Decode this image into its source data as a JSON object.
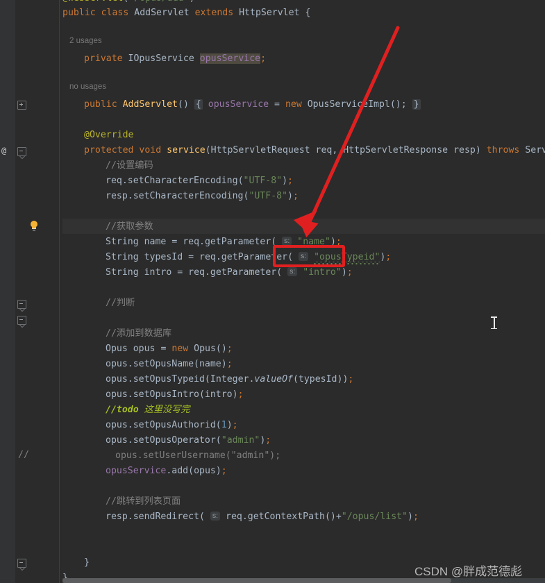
{
  "editor": {
    "language": "Java",
    "theme": "Darcula",
    "font_size": "13px",
    "background": "#2b2b2b",
    "current_line_background": "#323232"
  },
  "gutter": {
    "usage_hints": [
      {
        "text": "2 usages"
      },
      {
        "text": "no usages"
      }
    ],
    "annotation_at": "@",
    "commented_marker": "//",
    "bulb_icon": "lightbulb-intention-icon"
  },
  "code": {
    "lines": [
      {
        "id": "l0",
        "text": "@WebServlet(\"/opus/add\")"
      },
      {
        "id": "l1",
        "text": "public class AddServlet extends HttpServlet {"
      },
      {
        "id": "l2",
        "text": ""
      },
      {
        "id": "l3",
        "text": "2 usages"
      },
      {
        "id": "l4",
        "text": "private IOpusService opusService;"
      },
      {
        "id": "l5",
        "text": ""
      },
      {
        "id": "l6",
        "text": "no usages"
      },
      {
        "id": "l7",
        "text": "public AddServlet() { opusService = new OpusServiceImpl(); }"
      },
      {
        "id": "l8",
        "text": ""
      },
      {
        "id": "l9",
        "text": "@Override"
      },
      {
        "id": "l10",
        "text": "protected void service(HttpServletRequest req, HttpServletResponse resp) throws ServletExc"
      },
      {
        "id": "l11",
        "text": "//设置编码"
      },
      {
        "id": "l12",
        "text": "req.setCharacterEncoding(\"UTF-8\");"
      },
      {
        "id": "l13",
        "text": "resp.setCharacterEncoding(\"UTF-8\");"
      },
      {
        "id": "l14",
        "text": ""
      },
      {
        "id": "l15",
        "text": "//获取参数"
      },
      {
        "id": "l16",
        "text": "String name = req.getParameter( s: \"name\");"
      },
      {
        "id": "l17",
        "text": "String typesId = req.getParameter( s: \"opusTypeid\");"
      },
      {
        "id": "l18",
        "text": "String intro = req.getParameter( s: \"intro\");"
      },
      {
        "id": "l19",
        "text": ""
      },
      {
        "id": "l20",
        "text": "//判断"
      },
      {
        "id": "l21",
        "text": ""
      },
      {
        "id": "l22",
        "text": "//添加到数据库"
      },
      {
        "id": "l23",
        "text": "Opus opus = new Opus();"
      },
      {
        "id": "l24",
        "text": "opus.setOpusName(name);"
      },
      {
        "id": "l25",
        "text": "opus.setOpusTypeid(Integer.valueOf(typesId));"
      },
      {
        "id": "l26",
        "text": "opus.setOpusIntro(intro);"
      },
      {
        "id": "l27",
        "text": "//todo 这里没写完"
      },
      {
        "id": "l28",
        "text": "opus.setOpusAuthorid(1);"
      },
      {
        "id": "l29",
        "text": "opus.setOpusOperator(\"admin\");"
      },
      {
        "id": "l30",
        "text": "opus.setUserUsername(\"admin\");"
      },
      {
        "id": "l31",
        "text": "opusService.add(opus);"
      },
      {
        "id": "l32",
        "text": ""
      },
      {
        "id": "l33",
        "text": "//跳转到列表页面"
      },
      {
        "id": "l34",
        "text": "resp.sendRedirect( s: req.getContextPath()+\"/opus/list\");"
      },
      {
        "id": "l35",
        "text": ""
      },
      {
        "id": "l36",
        "text": "}"
      },
      {
        "id": "l37",
        "text": "}"
      }
    ],
    "tokens": {
      "kw_public": "public",
      "kw_class": "class",
      "kw_extends": "extends",
      "kw_private": "private",
      "kw_protected": "protected",
      "kw_void": "void",
      "kw_new": "new",
      "kw_throws": "throws",
      "type_AddServlet": "AddServlet",
      "type_HttpServlet": "HttpServlet",
      "type_IOpusService": "IOpusService",
      "field_opusService": "opusService",
      "type_OpusServiceImpl": "OpusServiceImpl",
      "anno_WebServlet": "@WebServlet",
      "anno_Override": "@Override",
      "mth_service": "service",
      "type_HttpServletRequest": "HttpServletRequest",
      "param_req": "req",
      "type_HttpServletResponse": "HttpServletResponse",
      "param_resp": "resp",
      "type_ServletException": "ServletExc",
      "str_utf8": "\"UTF-8\"",
      "str_name": "\"name\"",
      "str_opusTypeid": "\"opusTypeid\"",
      "str_intro": "\"intro\"",
      "str_admin": "\"admin\"",
      "str_opuslist": "\"/opus/list\"",
      "str_opusadd": "\"/opus/add\"",
      "hint_s": "s:",
      "cmt_encoding": "//设置编码",
      "cmt_params": "//获取参数",
      "cmt_judge": "//判断",
      "cmt_db": "//添加到数据库",
      "cmt_todo_kw": "//todo",
      "cmt_todo_text": "这里没写完",
      "cmt_redirect": "//跳转到列表页面",
      "type_Opus": "Opus",
      "var_opus": "opus",
      "type_Integer": "Integer",
      "mth_valueOf": "valueOf",
      "var_typesId": "typesId",
      "var_name": "name",
      "var_intro": "intro",
      "num_1": "1"
    }
  },
  "annotations": {
    "red_box": {
      "target_text": "\"opusTypeid\"",
      "color": "#e02020"
    },
    "red_arrow": {
      "color": "#e02020",
      "from": "top-right",
      "to": "opusTypeid-line"
    }
  },
  "watermark": {
    "text": "CSDN @胖成范德彪"
  },
  "cursor": {
    "type": "i-beam-text-cursor"
  }
}
